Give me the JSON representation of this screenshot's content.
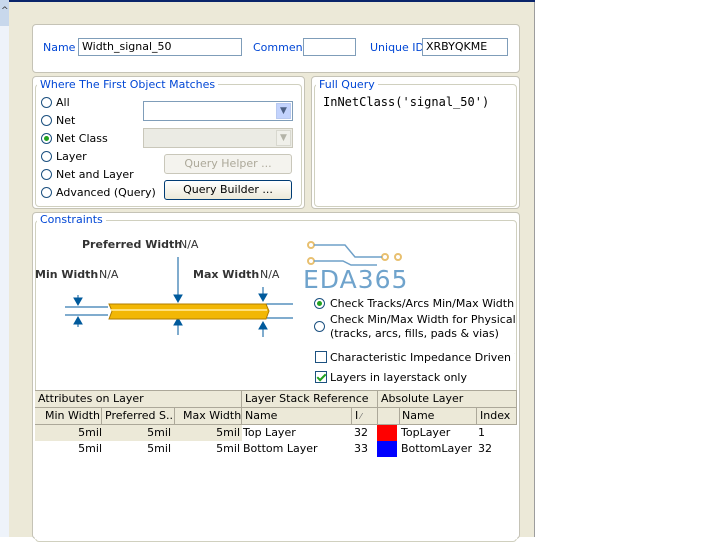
{
  "left_strip": {
    "glyph": "^",
    "icon": "chevron-up-icon"
  },
  "top_fields": {
    "name_label": "Name",
    "name_value": "Width_signal_50",
    "comment_label": "Comment",
    "comment_value": "",
    "unique_id_label": "Unique ID",
    "unique_id_value": "XRBYQKME"
  },
  "first_object": {
    "title": "Where The First Object Matches",
    "options": [
      {
        "label": "All",
        "selected": false
      },
      {
        "label": "Net",
        "selected": false
      },
      {
        "label": "Net Class",
        "selected": true
      },
      {
        "label": "Layer",
        "selected": false
      },
      {
        "label": "Net and Layer",
        "selected": false
      },
      {
        "label": "Advanced (Query)",
        "selected": false
      }
    ],
    "query_helper_label": "Query Helper ...",
    "query_builder_label": "Query Builder ..."
  },
  "full_query": {
    "title": "Full Query",
    "text": "InNetClass('signal_50')"
  },
  "constraints": {
    "title": "Constraints",
    "preferred_width_label": "Preferred Width",
    "preferred_width_value": "N/A",
    "min_width_label": "Min Width",
    "min_width_value": "N/A",
    "max_width_label": "Max Width",
    "max_width_value": "N/A",
    "watermark": "EDA365",
    "check_mode_options": [
      {
        "label": "Check Tracks/Arcs Min/Max Width Ind",
        "selected": true
      },
      {
        "label": "Check Min/Max Width for Physically Co",
        "sublabel": "(tracks, arcs, fills, pads & vias)",
        "selected": false
      }
    ],
    "impedance_label": "Characteristic Impedance Driven Width",
    "impedance_checked": false,
    "layerstack_label": "Layers in layerstack only",
    "layerstack_checked": true
  },
  "layer_table": {
    "group_headers": [
      "Attributes on Layer",
      "Layer Stack Reference",
      "Absolute Layer"
    ],
    "columns": [
      "Min Width",
      "Preferred S...",
      "Max Width",
      "Name",
      "I",
      "Name",
      "Index"
    ],
    "rows": [
      {
        "min": "5mil",
        "pref": "5mil",
        "max": "5mil",
        "name": "Top Layer",
        "i": "32",
        "color": "#ff0000",
        "abs_name": "TopLayer",
        "index": "1"
      },
      {
        "min": "5mil",
        "pref": "5mil",
        "max": "5mil",
        "name": "Bottom Layer",
        "i": "33",
        "color": "#0000ff",
        "abs_name": "BottomLayer",
        "index": "32"
      }
    ]
  }
}
